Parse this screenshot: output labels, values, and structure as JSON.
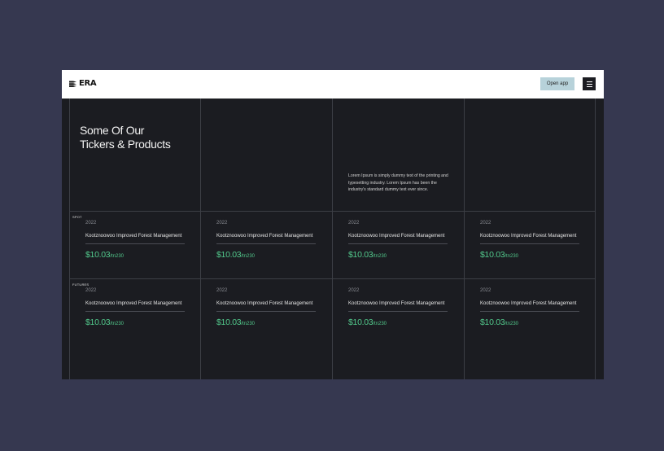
{
  "nav": {
    "logo_text": "ERA",
    "open_app_label": "Open app"
  },
  "hero": {
    "title_line1": "Some Of Our",
    "title_line2": "Tickers & Products",
    "description": "Lorem Ipsum is simply dummy text of the printing and typesetting industry. Lorem Ipsum has been the industry's standard dummy text ever since."
  },
  "sections": [
    {
      "label": "SPOT",
      "cards": [
        {
          "year": "2022",
          "name": "Kootznoowoo Improved Forest Management",
          "price": "$10.03",
          "unit": "/tn230"
        },
        {
          "year": "2022",
          "name": "Kootznoowoo Improved Forest Management",
          "price": "$10.03",
          "unit": "/tn230"
        },
        {
          "year": "2022",
          "name": "Kootznoowoo Improved Forest Management",
          "price": "$10.03",
          "unit": "/tn230"
        },
        {
          "year": "2022",
          "name": "Kootznoowoo Improved Forest Management",
          "price": "$10.03",
          "unit": "/tn230"
        }
      ]
    },
    {
      "label": "FUTURES",
      "cards": [
        {
          "year": "2022",
          "name": "Kootznoowoo Improved Forest Management",
          "price": "$10.03",
          "unit": "/tn230"
        },
        {
          "year": "2022",
          "name": "Kootznoowoo Improved Forest Management",
          "price": "$10.03",
          "unit": "/tn230"
        },
        {
          "year": "2022",
          "name": "Kootznoowoo Improved Forest Management",
          "price": "$10.03",
          "unit": "/tn230"
        },
        {
          "year": "2022",
          "name": "Kootznoowoo Improved Forest Management",
          "price": "$10.03",
          "unit": "/tn230"
        }
      ]
    }
  ],
  "colors": {
    "page_background": "#363850",
    "panel_background": "#1b1c21",
    "accent_green": "#52c98c",
    "button_background": "#b7d2da"
  },
  "icons": {
    "logo": "era-logo-icon",
    "menu": "hamburger-menu-icon"
  }
}
